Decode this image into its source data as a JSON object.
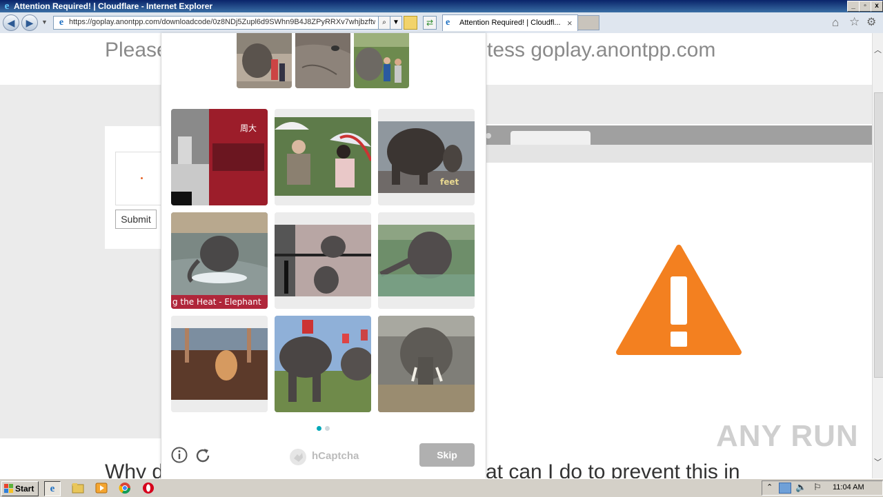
{
  "window": {
    "title": "Attention Required! | Cloudflare - Internet Explorer",
    "buttons": [
      "_",
      "▫",
      "x"
    ]
  },
  "navbar": {
    "url": "https://goplay.anontpp.com/downloadcode/0z8NDj5Zupl6d9SWhn9B4J8ZPyRRXv7whjbzftw",
    "tab_title": "Attention Required! | Cloudfl...",
    "tab_close": "×"
  },
  "page": {
    "headline_left": "Please",
    "headline_right": "tess goplay.anontpp.com",
    "submit_label": "Submit",
    "bottom_left": "Why d",
    "bottom_right": "at can I do to prevent this in",
    "warning_color": "#f38020"
  },
  "captcha": {
    "sample_images": [
      "elephant-with-people",
      "elephant-skin-closeup",
      "elephant-crowd"
    ],
    "grid": [
      {
        "label": "red-bus-street"
      },
      {
        "label": "people-umbrellas"
      },
      {
        "label": "elephant-feet",
        "caption": "feet"
      },
      {
        "label": "elephant-bathing",
        "caption": "g the Heat - Elephant"
      },
      {
        "label": "elephants-enclosure"
      },
      {
        "label": "elephant-in-water"
      },
      {
        "label": "dog-on-floor"
      },
      {
        "label": "elephants-with-riders"
      },
      {
        "label": "elephant-tusks"
      }
    ],
    "pager": {
      "current": 1,
      "total": 2
    },
    "brand": "hCaptcha",
    "skip_label": "Skip",
    "accent_color": "#00a8b8"
  },
  "taskbar": {
    "start_label": "Start",
    "clock": "11:04 AM"
  },
  "watermark": "ANY RUN"
}
